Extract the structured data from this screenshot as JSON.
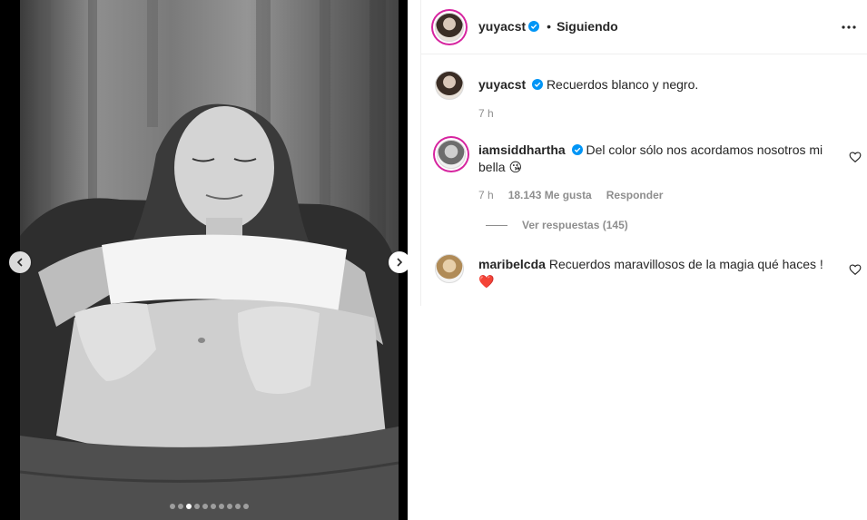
{
  "carousel": {
    "total_dots": 10,
    "active_index": 2
  },
  "header": {
    "username": "yuyacst",
    "separator": "•",
    "follow_status": "Siguiendo"
  },
  "caption": {
    "username": "yuyacst",
    "text": "Recuerdos blanco y negro.",
    "time": "7 h"
  },
  "comments": [
    {
      "username": "iamsiddhartha",
      "text": "Del color sólo nos acordamos nosotros mi bella 😘",
      "time": "7 h",
      "likes": "18.143 Me gusta",
      "reply_label": "Responder",
      "view_replies": "Ver respuestas (145)"
    },
    {
      "username": "maribelcda",
      "text": "Recuerdos maravillosos de la magia qué haces ! ❤️"
    }
  ],
  "colors": {
    "verified": "#0095f6",
    "text": "#262626",
    "secondary": "#8e8e8e",
    "heart_emoji": "#e0245e"
  },
  "icons": {
    "prev": "chevron-left-icon",
    "next": "chevron-right-icon",
    "more": "more-options-icon",
    "like": "heart-outline-icon",
    "verified": "verified-badge-icon"
  }
}
